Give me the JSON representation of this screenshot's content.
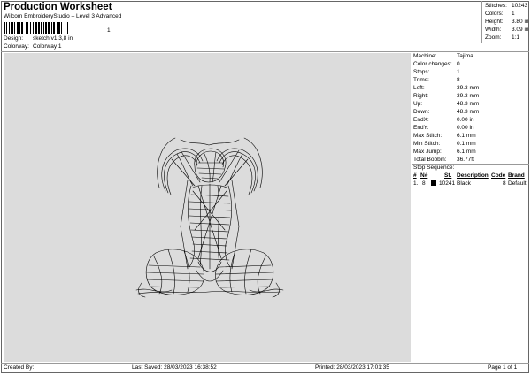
{
  "header": {
    "title": "Production Worksheet",
    "subtitle": "Wilcom EmbroideryStudio – Level 3 Advanced",
    "barcode_suffix": "1",
    "design_label": "Design:",
    "design_value": "sketch v1 3,8 in",
    "colorway_label": "Colorway:",
    "colorway_value": "Colorway 1"
  },
  "stats": [
    {
      "label": "Stitches:",
      "value": "10243"
    },
    {
      "label": "Colors:",
      "value": "1"
    },
    {
      "label": "Height:",
      "value": "3.80 in"
    },
    {
      "label": "Width:",
      "value": "3.09 in"
    },
    {
      "label": "Zoom:",
      "value": "1:1"
    }
  ],
  "details": [
    {
      "label": "Machine:",
      "value": "Tajima"
    },
    {
      "label": "Color changes:",
      "value": "0"
    },
    {
      "label": "Stops:",
      "value": "1"
    },
    {
      "label": "Trims:",
      "value": "8"
    },
    {
      "label": "Left:",
      "value": "39.3 mm"
    },
    {
      "label": "Right:",
      "value": "39.3 mm"
    },
    {
      "label": "Up:",
      "value": "48.3 mm"
    },
    {
      "label": "Down:",
      "value": "48.3 mm"
    },
    {
      "label": "EndX:",
      "value": "0.00 in"
    },
    {
      "label": "EndY:",
      "value": "0.00 in"
    },
    {
      "label": "Max Stitch:",
      "value": "6.1 mm"
    },
    {
      "label": "Min Stitch:",
      "value": "0.1 mm"
    },
    {
      "label": "Max Jump:",
      "value": "6.1 mm"
    },
    {
      "label": "Total Bobbin:",
      "value": "36.77ft"
    }
  ],
  "stop_sequence": {
    "title": "Stop Sequence:",
    "headers": {
      "num": "#",
      "n": "N#",
      "st": "St.",
      "description": "Description",
      "code": "Code",
      "brand": "Brand"
    },
    "rows": [
      {
        "num": "1.",
        "n": "8",
        "st": "10241",
        "description": "Black",
        "code": "8",
        "brand": "Default",
        "color": "#000000"
      }
    ]
  },
  "footer": {
    "created_by": "Created By:",
    "last_saved": "Last Saved: 28/03/2023 16:38:52",
    "printed": "Printed: 28/03/2023 17:01:35",
    "page": "Page 1 of 1"
  },
  "colors": {
    "canvas_bg": "#dcdcdc",
    "thread": "#000000"
  }
}
